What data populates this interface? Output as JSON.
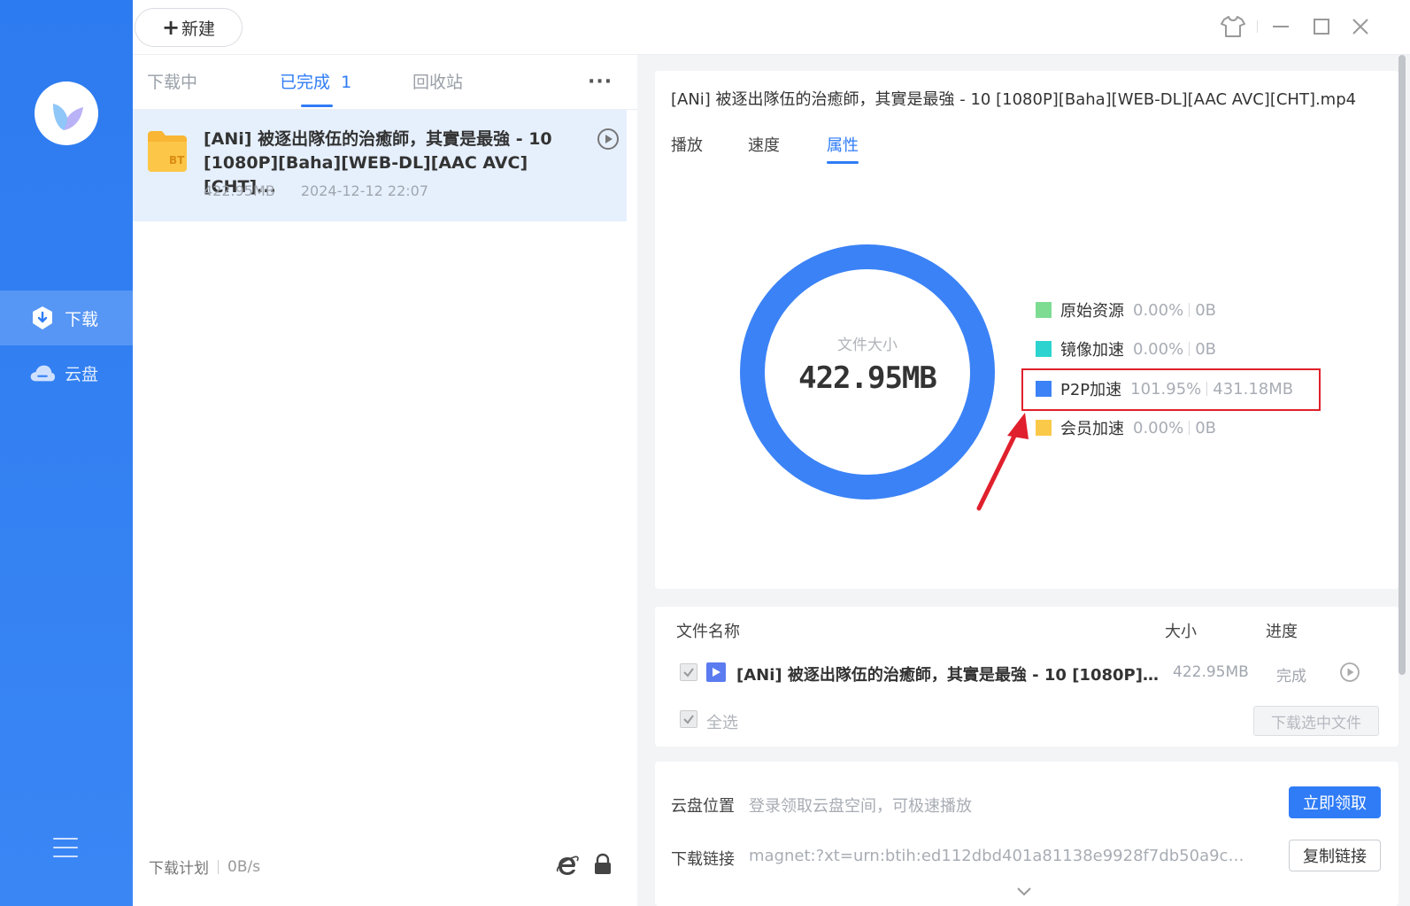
{
  "toolbar": {
    "new_label": "新建"
  },
  "sidebar": {
    "items": [
      {
        "label": "下载",
        "icon": "download-shield-icon",
        "active": true
      },
      {
        "label": "云盘",
        "icon": "cloud-drive-icon",
        "active": false
      }
    ]
  },
  "list": {
    "tabs": [
      {
        "label": "下载中"
      },
      {
        "label": "已完成",
        "count": "1"
      },
      {
        "label": "回收站"
      }
    ],
    "more_label": "···",
    "task": {
      "type_badge": "BT",
      "title": "[ANi] 被逐出隊伍的治癒師，其實是最強 - 10 [1080P][Baha][WEB-DL][AAC AVC][CHT]...",
      "size": "422.95MB",
      "time": "2024-12-12 22:07"
    },
    "footer": {
      "plan_label": "下载计划",
      "speed": "0B/s"
    }
  },
  "detail": {
    "file_title": "[ANi] 被逐出隊伍的治癒師，其實是最強 - 10 [1080P][Baha][WEB-DL][AAC AVC][CHT].mp4",
    "tabs": [
      {
        "label": "播放"
      },
      {
        "label": "速度"
      },
      {
        "label": "属性"
      }
    ],
    "donut": {
      "label": "文件大小",
      "value": "422.95MB",
      "color": "#3b82f6"
    },
    "legend": [
      {
        "name": "原始资源",
        "pct": "0.00%",
        "size": "0B",
        "color": "#7ddc92"
      },
      {
        "name": "镜像加速",
        "pct": "0.00%",
        "size": "0B",
        "color": "#2dd4cf"
      },
      {
        "name": "P2P加速",
        "pct": "101.95%",
        "size": "431.18MB",
        "color": "#3b82f6"
      },
      {
        "name": "会员加速",
        "pct": "0.00%",
        "size": "0B",
        "color": "#fbc94a"
      }
    ],
    "files": {
      "headers": {
        "name": "文件名称",
        "size": "大小",
        "progress": "进度"
      },
      "rows": [
        {
          "name": "[ANi] 被逐出隊伍的治癒師，其實是最強 - 10 [1080P][B...",
          "size": "422.95MB",
          "status": "完成"
        }
      ],
      "select_all": "全选",
      "download_selected": "下载选中文件"
    },
    "cloud": {
      "location_label": "云盘位置",
      "location_value": "登录领取云盘空间，可极速播放",
      "claim_button": "立即领取",
      "link_label": "下载链接",
      "link_value": "magnet:?xt=urn:btih:ed112dbd401a81138e9928f7db50a9cc90...",
      "copy_button": "复制链接"
    }
  },
  "colors": {
    "accent": "#2f7cf6",
    "annotation": "#e0202c"
  }
}
